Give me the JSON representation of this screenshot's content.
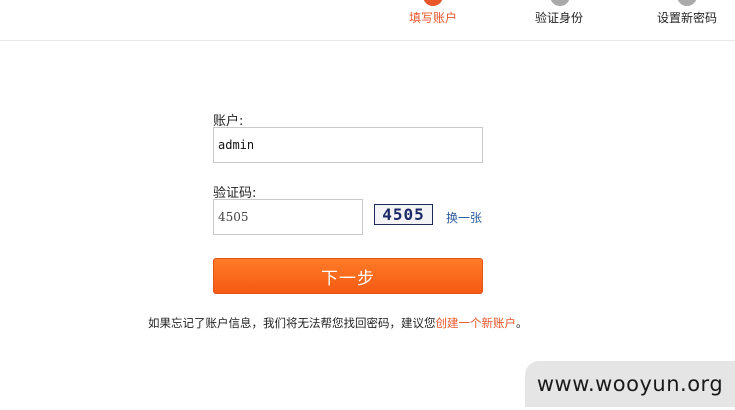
{
  "steps": [
    {
      "label": "填写账户",
      "active": true
    },
    {
      "label": "验证身份",
      "active": false
    },
    {
      "label": "设置新密码",
      "active": false
    }
  ],
  "form": {
    "account_label": "账户:",
    "account_value": "admin",
    "captcha_label": "验证码:",
    "captcha_value": "4505",
    "captcha_image_text": "4505",
    "refresh_label": "换一张",
    "next_label": "下一步"
  },
  "note": {
    "prefix": "如果忘记了账户信息，我们将无法帮您找回密码，建议您",
    "link": "创建一个新账户",
    "suffix": "。"
  },
  "watermark": "www.wooyun.org",
  "colors": {
    "accent": "#e8562a",
    "button_top": "#ff7b28",
    "button_bottom": "#f45a12",
    "link_blue": "#2b5b9a"
  }
}
